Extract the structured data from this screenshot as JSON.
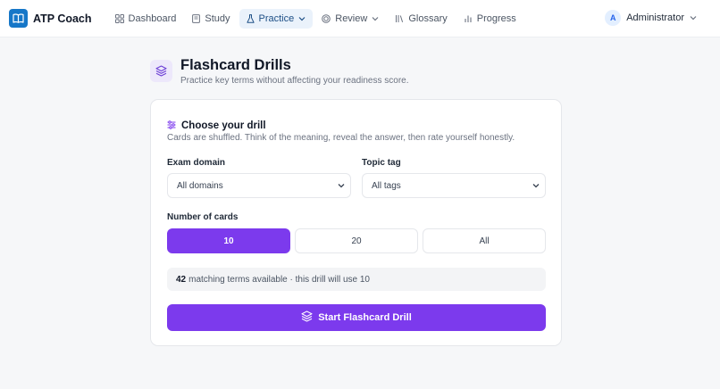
{
  "brand": {
    "name": "ATP Coach"
  },
  "nav": {
    "items": [
      {
        "label": "Dashboard",
        "icon": "grid-icon"
      },
      {
        "label": "Study",
        "icon": "book-icon"
      },
      {
        "label": "Practice",
        "icon": "flask-icon",
        "active": true,
        "dropdown": true
      },
      {
        "label": "Review",
        "icon": "target-icon",
        "dropdown": true
      },
      {
        "label": "Glossary",
        "icon": "library-icon"
      },
      {
        "label": "Progress",
        "icon": "bar-chart-icon"
      }
    ]
  },
  "user": {
    "initial": "A",
    "name": "Administrator"
  },
  "page": {
    "title": "Flashcard Drills",
    "subtitle": "Practice key terms without affecting your readiness score."
  },
  "drill": {
    "title": "Choose your drill",
    "description": "Cards are shuffled. Think of the meaning, reveal the answer, then rate yourself honestly.",
    "domain_label": "Exam domain",
    "domain_value": "All domains",
    "tag_label": "Topic tag",
    "tag_value": "All tags",
    "count_label": "Number of cards",
    "count_options": [
      "10",
      "20",
      "All"
    ],
    "count_selected": "10",
    "matching_count": "42",
    "matching_text": "matching terms available · this drill will use 10",
    "start_label": "Start Flashcard Drill"
  },
  "colors": {
    "accent": "#7c3aed",
    "brand": "#1677c8",
    "nav_active_bg": "#eaf2fb"
  }
}
